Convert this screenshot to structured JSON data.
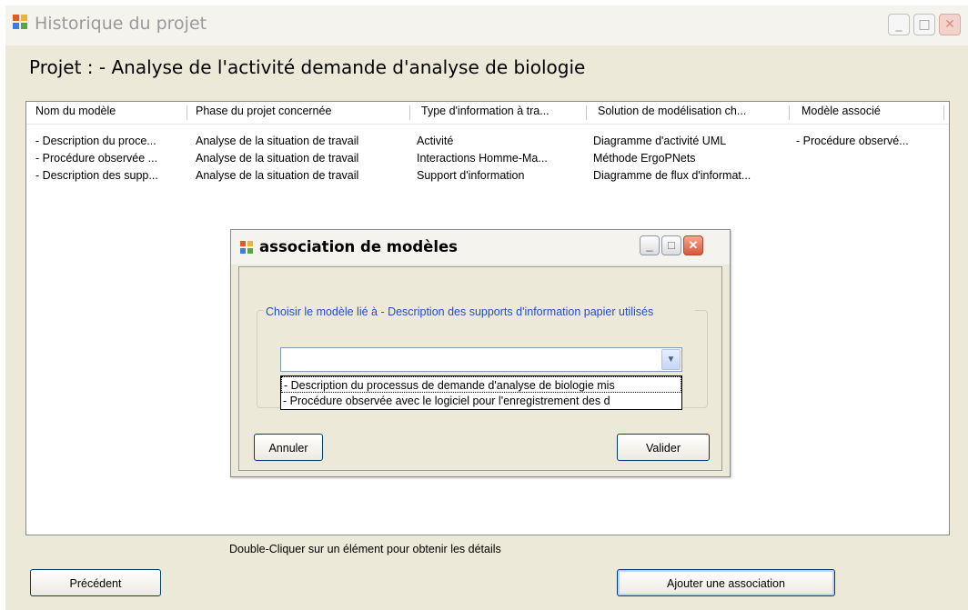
{
  "window": {
    "title": "Historique du projet",
    "controls": [
      "minimize",
      "maximize",
      "close"
    ]
  },
  "heading": "Projet : - Analyse de l'activité demande d'analyse de biologie",
  "list": {
    "columns": [
      "Nom du modèle",
      "Phase du projet concernée",
      "Type d'information à tra...",
      "Solution de modélisation ch...",
      "Modèle associé"
    ],
    "rows": [
      [
        "- Description du proce...",
        "Analyse de la situation de travail",
        "Activité",
        "Diagramme d'activité UML",
        "- Procédure observé..."
      ],
      [
        "- Procédure observée ...",
        "Analyse de la situation de travail",
        "Interactions Homme-Ma...",
        "Méthode ErgoPNets",
        ""
      ],
      [
        "- Description des supp...",
        "Analyse de la situation de travail",
        "Support d'information",
        "Diagramme de flux d'informat...",
        ""
      ]
    ]
  },
  "hint": "Double-Cliquer sur un élément pour obtenir les détails",
  "buttons": {
    "previous": "Précédent",
    "add_association": "Ajouter une association"
  },
  "dialog": {
    "title": "association de modèles",
    "group_label": "Choisir le modèle lié à - Description des supports d'information papier utilisés",
    "combo_value": "",
    "options": [
      "- Description du processus de demande d'analyse de biologie mis",
      "- Procédure observée avec le logiciel pour l'enregistrement des d"
    ],
    "cancel": "Annuler",
    "ok": "Valider"
  },
  "colors": {
    "window_bg": "#ece9d8",
    "legend_text": "#1f4fc8",
    "close_button": "#d9563a"
  }
}
